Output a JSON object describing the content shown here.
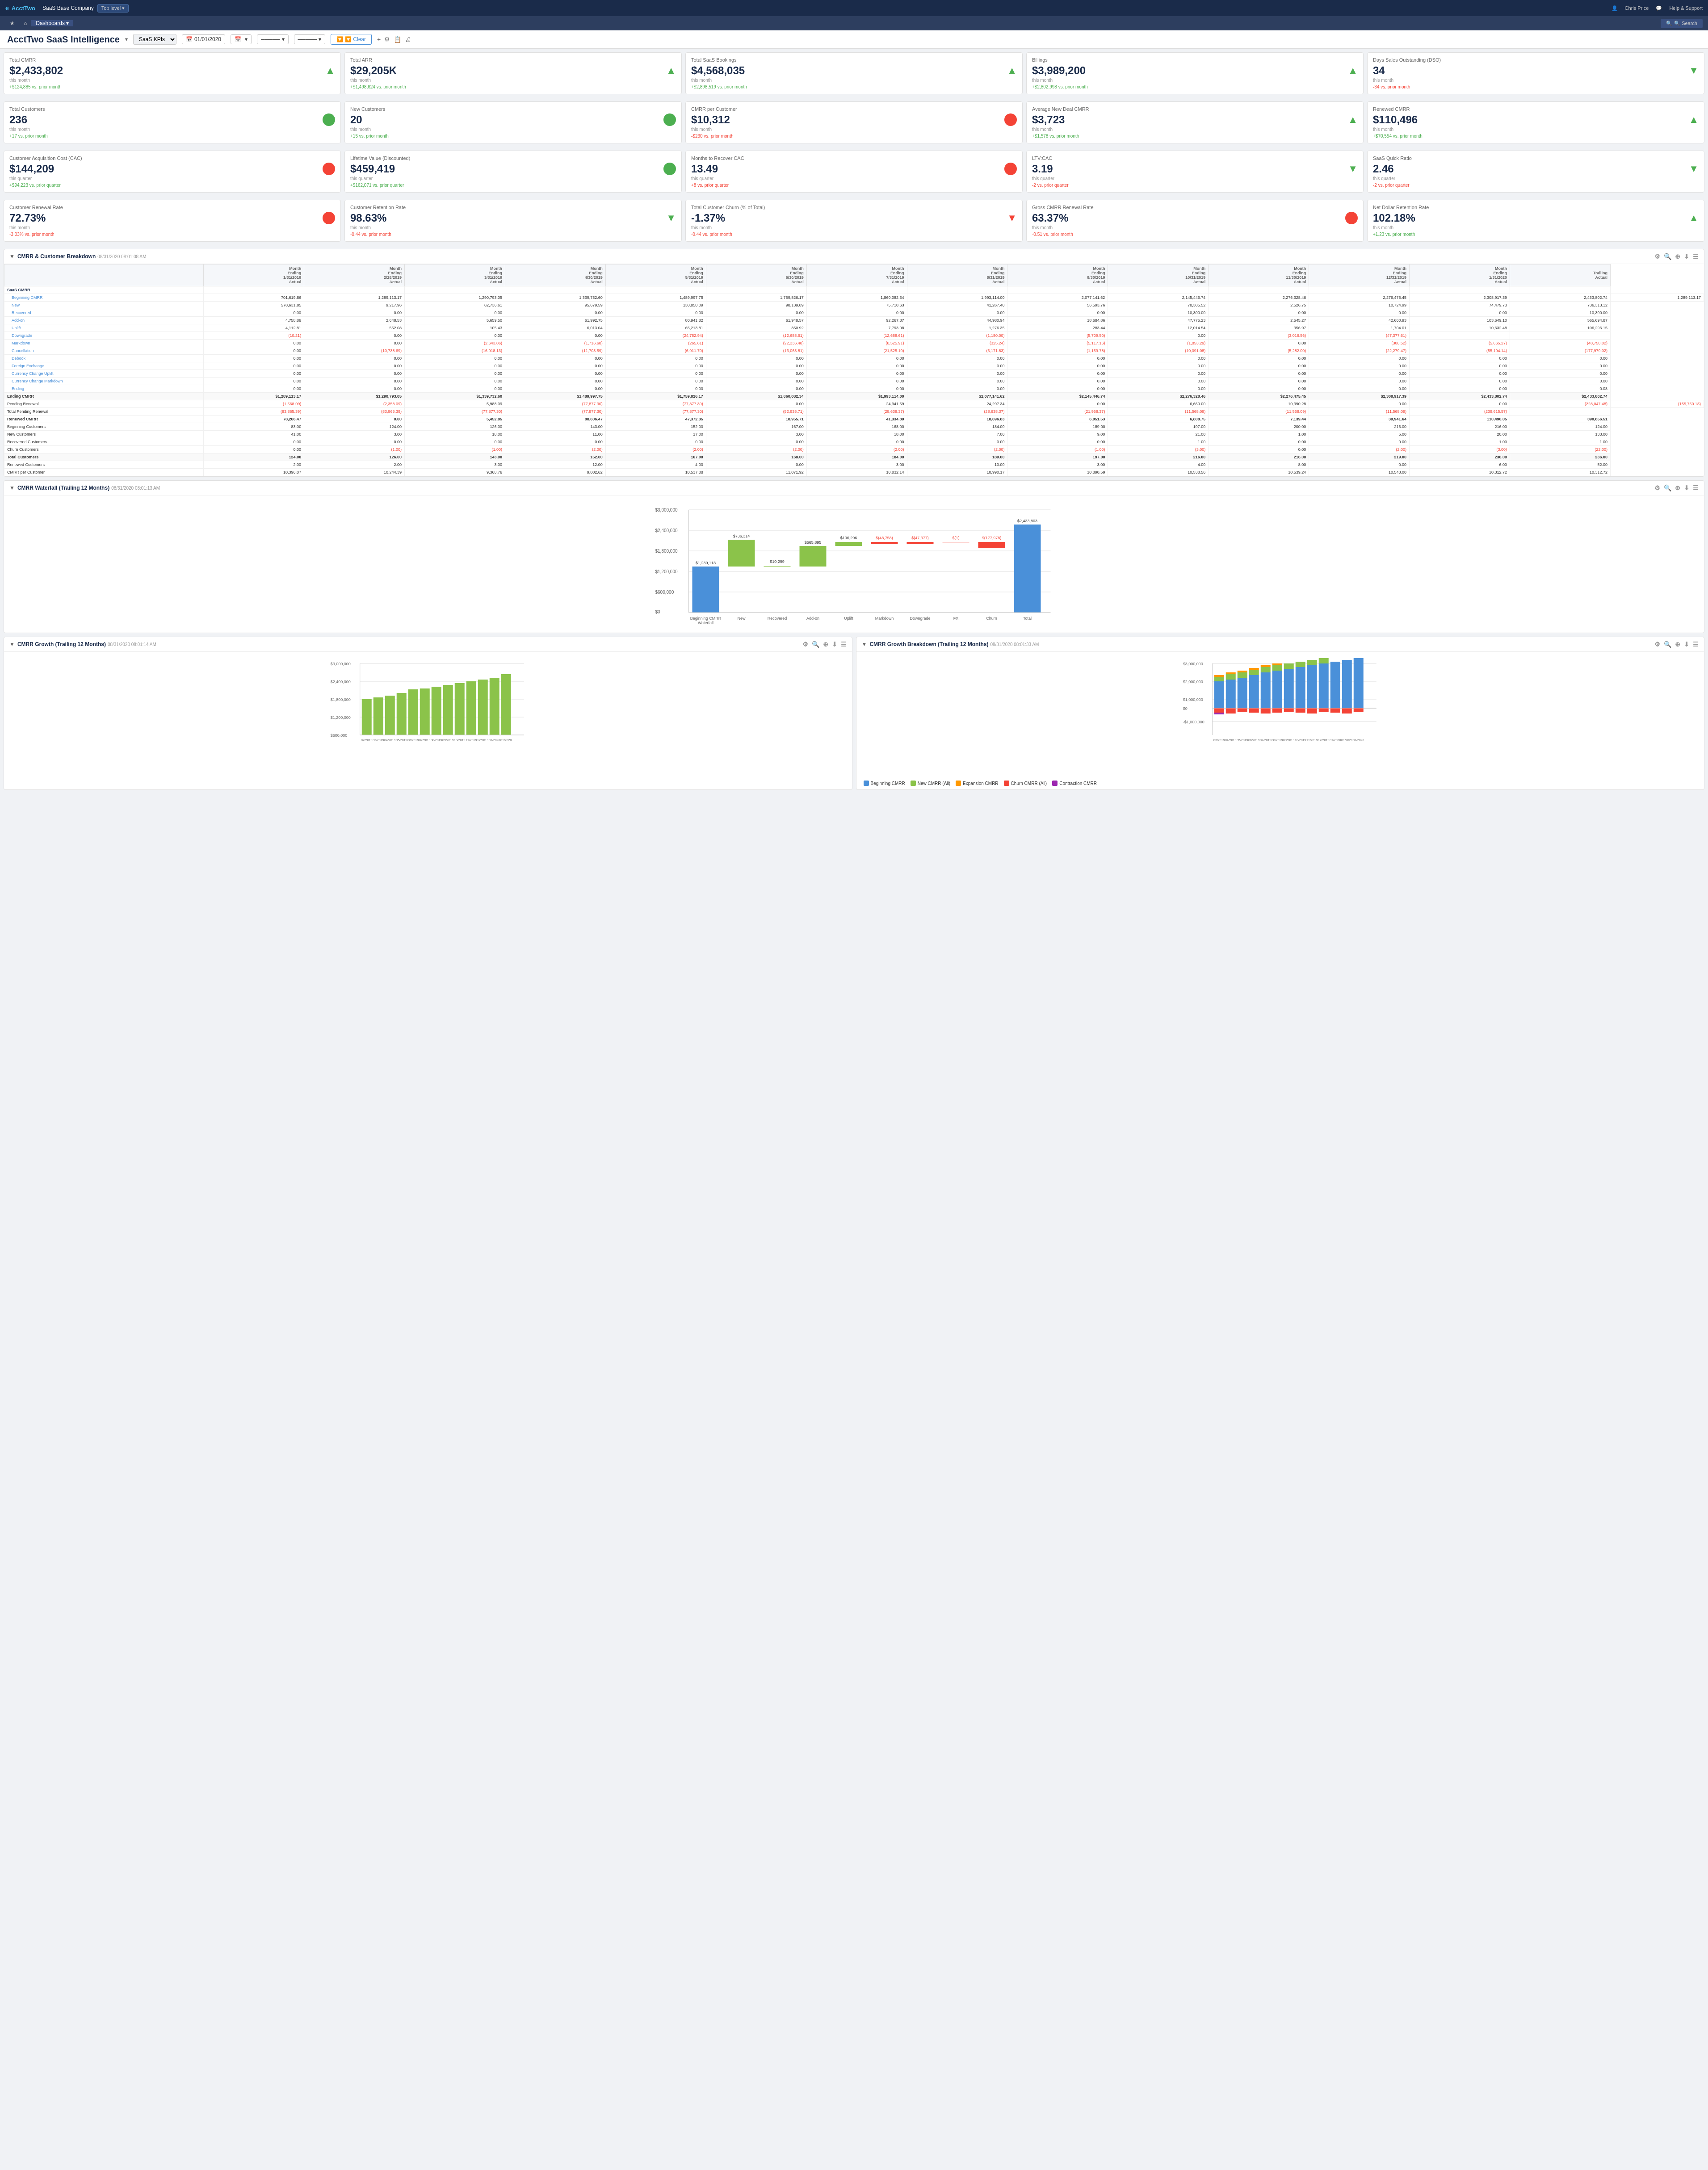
{
  "topNav": {
    "logo": "AcctTwo",
    "companyName": "SaaS Base Company",
    "levelLabel": "Top level ▾",
    "userLabel": "Chris Price",
    "helpLabel": "Help & Support"
  },
  "secondNav": {
    "items": [
      {
        "label": "★",
        "name": "favorites"
      },
      {
        "label": "⌂",
        "name": "home"
      },
      {
        "label": "Dashboards ▾",
        "name": "dashboards",
        "active": true
      }
    ],
    "searchLabel": "🔍 Search"
  },
  "pageHeader": {
    "title": "AcctTwo SaaS Intelligence",
    "dashboardSelector": "SaaS KPIs",
    "dateFrom": "01/01/2020",
    "clearLabel": "🔽 Clear",
    "searchLabel": "🔍 Search"
  },
  "kpiRows": [
    [
      {
        "label": "Total CMRR",
        "value": "$2,433,802",
        "arrow": "up",
        "change": "+$124,885 vs. prior month",
        "changeType": "positive",
        "period": "this month"
      },
      {
        "label": "Total ARR",
        "value": "$29,205K",
        "arrow": "up",
        "change": "+$1,498,624 vs. prior month",
        "changeType": "positive",
        "period": "this month"
      },
      {
        "label": "Total SaaS Bookings",
        "value": "$4,568,035",
        "arrow": "up",
        "change": "+$2,898,519 vs. prior month",
        "changeType": "positive",
        "period": "this month"
      },
      {
        "label": "Billings",
        "value": "$3,989,200",
        "arrow": "up",
        "change": "+$2,802,998 vs. prior month",
        "changeType": "positive",
        "period": "this month"
      },
      {
        "label": "Days Sales Outstanding (DSO)",
        "value": "34",
        "arrow": "down",
        "change": "-34 vs. prior month",
        "changeType": "negative",
        "period": "this month"
      }
    ],
    [
      {
        "label": "Total Customers",
        "value": "236",
        "indicator": "green",
        "change": "+17 vs. prior month",
        "changeType": "positive",
        "period": "this month"
      },
      {
        "label": "New Customers",
        "value": "20",
        "indicator": "green",
        "change": "+15 vs. prior month",
        "changeType": "positive",
        "period": "this month"
      },
      {
        "label": "CMRR per Customer",
        "value": "$10,312",
        "indicator": "red",
        "change": "-$230 vs. prior month",
        "changeType": "negative",
        "period": "this month"
      },
      {
        "label": "Average New Deal CMRR",
        "value": "$3,723",
        "arrow": "up",
        "change": "+$1,578 vs. prior month",
        "changeType": "positive",
        "period": "this month"
      },
      {
        "label": "Renewed CMRR",
        "value": "$110,496",
        "arrow": "up",
        "change": "+$70,554 vs. prior month",
        "changeType": "positive",
        "period": "this month"
      }
    ],
    [
      {
        "label": "Customer Acquisition Cost (CAC)",
        "value": "$144,209",
        "indicator": "red",
        "change": "+$94,223 vs. prior quarter",
        "changeType": "positive",
        "period": "this quarter"
      },
      {
        "label": "Lifetime Value (Discounted)",
        "value": "$459,419",
        "indicator": "green",
        "change": "+$162,071 vs. prior quarter",
        "changeType": "positive",
        "period": "this quarter"
      },
      {
        "label": "Months to Recover CAC",
        "value": "13.49",
        "indicator": "red",
        "change": "+8 vs. prior quarter",
        "changeType": "negative",
        "period": "this quarter"
      },
      {
        "label": "LTV:CAC",
        "value": "3.19",
        "arrow": "down",
        "change": "-2 vs. prior quarter",
        "changeType": "negative",
        "period": "this quarter"
      },
      {
        "label": "SaaS Quick Ratio",
        "value": "2.46",
        "arrow": "down",
        "change": "-2 vs. prior quarter",
        "changeType": "negative",
        "period": "this quarter"
      }
    ],
    [
      {
        "label": "Customer Renewal Rate",
        "value": "72.73%",
        "indicator": "red",
        "change": "-3.03% vs. prior month",
        "changeType": "negative",
        "period": "this month"
      },
      {
        "label": "Customer Retention Rate",
        "value": "98.63%",
        "arrow": "down",
        "change": "-0.44 vs. prior month",
        "changeType": "negative",
        "period": "this month"
      },
      {
        "label": "Total Customer Churn (% of Total)",
        "value": "-1.37%",
        "arrow": "down_red",
        "change": "-0.44 vs. prior month",
        "changeType": "negative",
        "period": "this month"
      },
      {
        "label": "Gross CMRR Renewal Rate",
        "value": "63.37%",
        "indicator": "red",
        "change": "-0.51 vs. prior month",
        "changeType": "negative",
        "period": "this month"
      },
      {
        "label": "Net Dollar Retention Rate",
        "value": "102.18%",
        "arrow": "up",
        "change": "+1.23 vs. prior month",
        "changeType": "positive",
        "period": "this month"
      }
    ]
  ],
  "cmrrTable": {
    "sectionTitle": "CMRR & Customer Breakdown",
    "sectionDate": "08/31/2020 08:01:08 AM",
    "columns": [
      "Month Ending 1/31/2019 Actual",
      "Month Ending 2/28/2019 Actual",
      "Month Ending 3/31/2019 Actual",
      "Month Ending 4/30/2019 Actual",
      "Month Ending 5/31/2019 Actual",
      "Month Ending 6/30/2019 Actual",
      "Month Ending 7/31/2019 Actual",
      "Month Ending 8/31/2019 Actual",
      "Month Ending 9/30/2019 Actual",
      "Month Ending 10/31/2019 Actual",
      "Month Ending 11/30/2019 Actual",
      "Month Ending 12/31/2019 Actual",
      "Month Ending 1/31/2020 Actual",
      "Trailing Actual"
    ],
    "rows": [
      {
        "label": "SaaS CMRR",
        "type": "section",
        "values": []
      },
      {
        "label": "Beginning CMRR",
        "type": "sub",
        "values": [
          "701,619.86",
          "1,289,113.17",
          "1,290,793.05",
          "1,339,732.60",
          "1,489,997.75",
          "1,759,826.17",
          "1,860,082.34",
          "1,993,114.00",
          "2,077,141.62",
          "2,145,446.74",
          "2,276,328.46",
          "2,276,475.45",
          "2,308,917.39",
          "2,433,802.74",
          "1,289,113.17"
        ]
      },
      {
        "label": "New",
        "type": "sub",
        "values": [
          "578,631.85",
          "9,217.96",
          "62,736.61",
          "95,679.59",
          "130,850.09",
          "98,139.89",
          "75,710.63",
          "41,267.40",
          "56,593.76",
          "78,385.52",
          "2,526.75",
          "10,724.99",
          "74,479.73",
          "736,313.12"
        ]
      },
      {
        "label": "Recovered",
        "type": "sub",
        "values": [
          "0.00",
          "0.00",
          "0.00",
          "0.00",
          "0.00",
          "0.00",
          "0.00",
          "0.00",
          "0.00",
          "10,300.00",
          "0.00",
          "0.00",
          "0.00",
          "10,300.00"
        ]
      },
      {
        "label": "Add-on",
        "type": "sub",
        "values": [
          "4,758.86",
          "2,648.53",
          "5,659.50",
          "61,992.75",
          "80,941.82",
          "61,948.57",
          "92,267.37",
          "44,980.94",
          "18,684.86",
          "47,775.23",
          "2,545.27",
          "42,600.93",
          "103,649.10",
          "565,694.87"
        ]
      },
      {
        "label": "Uplift",
        "type": "sub",
        "values": [
          "4,112.81",
          "552.08",
          "105.43",
          "6,013.04",
          "65,213.81",
          "350.92",
          "7,793.08",
          "1,276.35",
          "283.44",
          "12,014.54",
          "356.97",
          "1,704.01",
          "10,632.48",
          "106,296.15"
        ]
      },
      {
        "label": "Downgrade",
        "type": "sub",
        "values": [
          "(10.21)",
          "0.00",
          "0.00",
          "0.00",
          "(24,782.94)",
          "(12,688.61)",
          "(12,688.61)",
          "(1,180.00)",
          "(5,709.50)",
          "0.00",
          "(3,016.56)",
          "(47,377.61)"
        ]
      },
      {
        "label": "Markdown",
        "type": "sub",
        "values": [
          "0.00",
          "0.00",
          "(2,643.86)",
          "(1,716.68)",
          "(265.61)",
          "(22,336.48)",
          "(8,525.91)",
          "(325.24)",
          "(5,117.16)",
          "(1,853.29)",
          "0.00",
          "(308.52)",
          "(5,665.27)",
          "(48,758.02)"
        ]
      },
      {
        "label": "Cancellation",
        "type": "sub",
        "values": [
          "0.00",
          "(10,738.69)",
          "(16,918.13)",
          "(11,703.59)",
          "(6,911.70)",
          "(13,063.81)",
          "(21,525.10)",
          "(3,171.83)",
          "(1,159.78)",
          "(10,091.08)",
          "(5,282.00)",
          "(22,279.47)",
          "(55,194.14)",
          "(177,979.02)"
        ]
      },
      {
        "label": "Debook",
        "type": "sub",
        "values": [
          "0.00",
          "0.00",
          "0.00",
          "0.00",
          "0.00",
          "0.00",
          "0.00",
          "0.00",
          "0.00",
          "0.00",
          "0.00",
          "0.00",
          "0.00",
          "0.00"
        ]
      },
      {
        "label": "Foreign Exchange",
        "type": "sub",
        "values": [
          "0.00",
          "0.00",
          "0.00",
          "0.00",
          "0.00",
          "0.00",
          "0.00",
          "0.00",
          "0.00",
          "0.00",
          "0.00",
          "0.00",
          "0.00",
          "0.00"
        ]
      },
      {
        "label": "Currency Change Uplift",
        "type": "sub",
        "values": [
          "0.00",
          "0.00",
          "0.00",
          "0.00",
          "0.00",
          "0.00",
          "0.00",
          "0.00",
          "0.00",
          "0.00",
          "0.00",
          "0.00",
          "0.00",
          "0.00"
        ]
      },
      {
        "label": "Currency Change Markdown",
        "type": "sub",
        "values": [
          "0.00",
          "0.00",
          "0.00",
          "0.00",
          "0.00",
          "0.00",
          "0.00",
          "0.00",
          "0.00",
          "0.00",
          "0.00",
          "0.00",
          "0.00",
          "0.00"
        ]
      },
      {
        "label": "Ending",
        "type": "sub",
        "values": [
          "0.00",
          "0.00",
          "0.00",
          "0.00",
          "0.00",
          "0.00",
          "0.00",
          "0.00",
          "0.00",
          "0.00",
          "0.00",
          "0.00",
          "0.00",
          "0.08"
        ]
      },
      {
        "label": "Ending CMRR",
        "type": "total",
        "values": [
          "$1,289,113.17",
          "$1,290,793.05",
          "$1,339,732.60",
          "$1,489,997.75",
          "$1,759,826.17",
          "$1,860,082.34",
          "$1,993,114.00",
          "$2,077,141.62",
          "$2,145,446.74",
          "$2,276,328.46",
          "$2,276,475.45",
          "$2,308,917.39",
          "$2,433,802.74",
          "$2,433,802.74"
        ]
      },
      {
        "label": "Pending Renewal",
        "type": "normal",
        "values": [
          "(1,568.09)",
          "(2,358.09)",
          "5,988.09",
          "(77,877.30)",
          "(77,877.30)",
          "0.00",
          "24,941.59",
          "24,297.34",
          "0.00",
          "6,660.00",
          "10,390.28",
          "0.00",
          "0.00",
          "(228,047.48)",
          "(155,750.18)"
        ]
      },
      {
        "label": "Total Pending Renewal",
        "type": "normal",
        "values": [
          "(83,865.39)",
          "(83,865.39)",
          "(77,877.30)",
          "(77,877.30)",
          "(77,877.30)",
          "(52,935.71)",
          "(28,638.37)",
          "(28,638.37)",
          "(21,958.37)",
          "(11,568.09)",
          "(11,568.09)",
          "(11,568.09)",
          "(239,615.57)"
        ]
      },
      {
        "label": "Renewed CMRR",
        "type": "bold",
        "values": [
          "78,266.47",
          "0.00",
          "5,452.85",
          "88,606.47",
          "47,372.35",
          "18,955.71",
          "41,334.89",
          "18,696.83",
          "6,051.53",
          "6,808.75",
          "7,139.44",
          "39,941.64",
          "110,496.05",
          "390,856.51"
        ]
      },
      {
        "label": "Beginning Customers",
        "type": "normal",
        "values": [
          "83.00",
          "124.00",
          "126.00",
          "143.00",
          "152.00",
          "167.00",
          "168.00",
          "184.00",
          "189.00",
          "197.00",
          "200.00",
          "216.00",
          "216.00",
          "124.00"
        ]
      },
      {
        "label": "New Customers",
        "type": "normal",
        "values": [
          "41.00",
          "3.00",
          "18.00",
          "11.00",
          "17.00",
          "3.00",
          "18.00",
          "7.00",
          "9.00",
          "21.00",
          "1.00",
          "5.00",
          "20.00",
          "133.00"
        ]
      },
      {
        "label": "Recovered Customers",
        "type": "normal",
        "values": [
          "0.00",
          "0.00",
          "0.00",
          "0.00",
          "0.00",
          "0.00",
          "0.00",
          "0.00",
          "0.00",
          "1.00",
          "0.00",
          "0.00",
          "1.00",
          "1.00"
        ]
      },
      {
        "label": "Churn Customers",
        "type": "normal",
        "values": [
          "0.00",
          "(1.00)",
          "(1.00)",
          "(2.00)",
          "(2.00)",
          "(2.00)",
          "(2.00)",
          "(2.00)",
          "(1.00)",
          "(3.00)",
          "0.00",
          "(2.00)",
          "(3.00)",
          "(22.00)"
        ]
      },
      {
        "label": "Total Customers",
        "type": "total",
        "values": [
          "124.00",
          "126.00",
          "143.00",
          "152.00",
          "167.00",
          "168.00",
          "184.00",
          "189.00",
          "197.00",
          "216.00",
          "216.00",
          "219.00",
          "236.00",
          "236.00"
        ]
      },
      {
        "label": "Renewed Customers",
        "type": "normal",
        "values": [
          "2.00",
          "2.00",
          "3.00",
          "12.00",
          "4.00",
          "0.00",
          "3.00",
          "10.00",
          "3.00",
          "4.00",
          "8.00",
          "0.00",
          "6.00",
          "52.00"
        ]
      },
      {
        "label": "CMRR per Customer",
        "type": "normal",
        "values": [
          "10,396.07",
          "10,244.39",
          "9,368.76",
          "9,802.62",
          "10,537.88",
          "11,071.92",
          "10,832.14",
          "10,990.17",
          "10,890.59",
          "10,538.56",
          "10,539.24",
          "10,543.00",
          "10,312.72",
          "10,312.72"
        ]
      }
    ]
  },
  "waterfallChart": {
    "sectionTitle": "CMRR Waterfall (Trailing 12 Months)",
    "sectionDate": "08/31/2020 08:01:13 AM",
    "bars": [
      {
        "label": "Beginning CMRR\nWaterfall",
        "value": 1289113,
        "displayValue": "$1,289,113",
        "type": "base"
      },
      {
        "label": "New",
        "value": 736314,
        "displayValue": "$736,314",
        "type": "positive"
      },
      {
        "label": "Recovered",
        "value": 10299,
        "displayValue": "$10,299",
        "type": "positive"
      },
      {
        "label": "Add-on",
        "value": 565895,
        "displayValue": "$565,895",
        "type": "positive"
      },
      {
        "label": "Uplift",
        "value": 106296,
        "displayValue": "$106,296",
        "type": "positive"
      },
      {
        "label": "Markdown",
        "value": -48758,
        "displayValue": "$(48,758)",
        "type": "negative"
      },
      {
        "label": "Downgrade",
        "value": -47377,
        "displayValue": "$(47,377)",
        "type": "negative"
      },
      {
        "label": "FX",
        "value": -1,
        "displayValue": "$(1)",
        "type": "negative"
      },
      {
        "label": "Churn",
        "value": -177978,
        "displayValue": "$(177,978)",
        "type": "negative"
      },
      {
        "label": "Total",
        "value": 2433803,
        "displayValue": "$2,433,803",
        "type": "total"
      }
    ],
    "yAxisLabels": [
      "$3,000,000",
      "$2,400,000",
      "$1,800,000",
      "$1,200,000",
      "$600,000",
      "$0"
    ]
  },
  "cmrrGrowthChart": {
    "sectionTitle": "CMRR Growth (Trailing 12 Months)",
    "sectionDate": "08/31/2020 08:01:14 AM"
  },
  "cmrrGrowthBreakdownChart": {
    "sectionTitle": "CMRR Growth Breakdown (Trailing 12 Months)",
    "sectionDate": "08/31/2020 08:01:33 AM",
    "legend": [
      {
        "label": "Beginning CMRR",
        "color": "#4a90d9"
      },
      {
        "label": "New CMRR (All)",
        "color": "#8bc34a"
      },
      {
        "label": "Expansion CMRR",
        "color": "#ff9800"
      },
      {
        "label": "Churn CMRR (All)",
        "color": "#f44336"
      },
      {
        "label": "Contraction CMRR",
        "color": "#9c27b0"
      }
    ]
  },
  "icons": {
    "up_arrow": "▲",
    "down_arrow": "▼",
    "filter": "⚙",
    "search": "🔍",
    "collapse": "▼",
    "calendar": "📅"
  }
}
